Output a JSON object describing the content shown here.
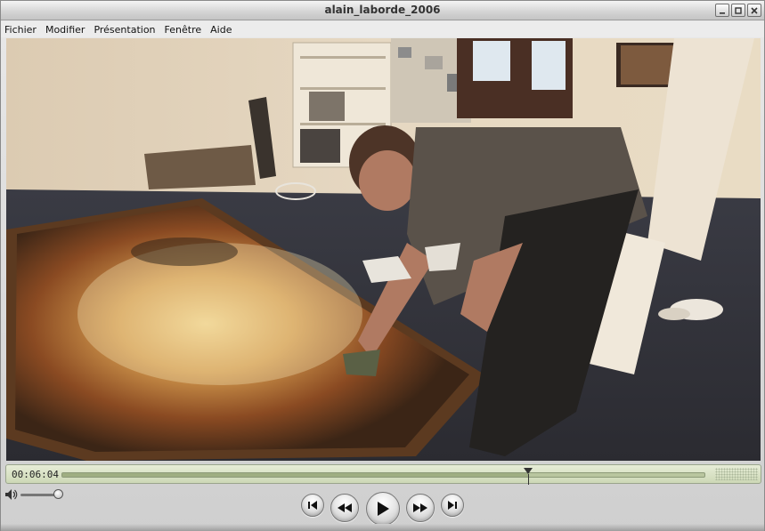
{
  "window": {
    "title": "alain_laborde_2006"
  },
  "menu": {
    "items": [
      "Fichier",
      "Modifier",
      "Présentation",
      "Fenêtre",
      "Aide"
    ]
  },
  "video": {
    "scene": "video-frame"
  },
  "timeline": {
    "timecode": "00:06:04",
    "progress": 0.725
  },
  "controls": {
    "volume_level": 1.0,
    "buttons": [
      "skip-back-icon",
      "rewind-icon",
      "play-icon",
      "fast-forward-icon",
      "skip-forward-icon"
    ]
  },
  "colors": {
    "timeline_bg": "#d5dfbf",
    "playhead": "#333333"
  }
}
